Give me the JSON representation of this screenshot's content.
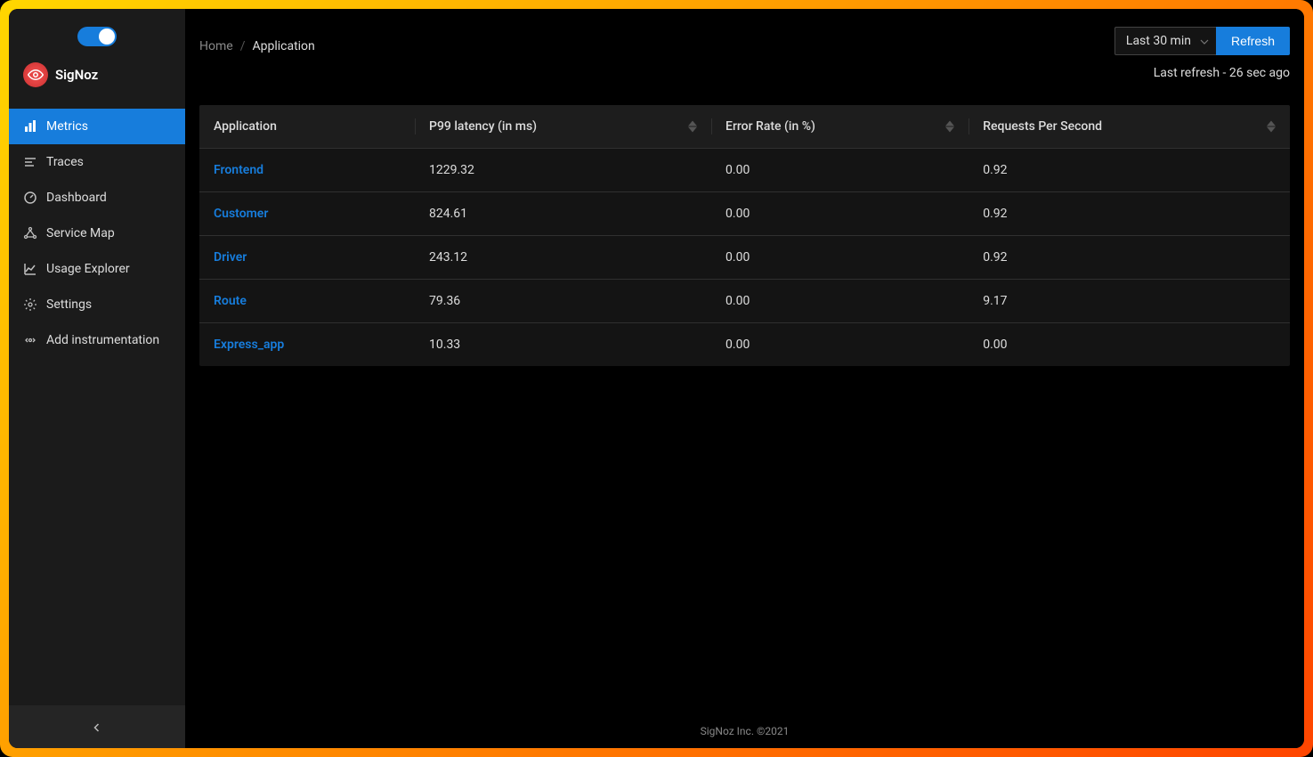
{
  "brand": {
    "name": "SigNoz"
  },
  "sidebar": {
    "items": [
      {
        "label": "Metrics",
        "icon": "chart-bar-icon",
        "active": true
      },
      {
        "label": "Traces",
        "icon": "align-left-icon",
        "active": false
      },
      {
        "label": "Dashboard",
        "icon": "dashboard-icon",
        "active": false
      },
      {
        "label": "Service Map",
        "icon": "deployment-icon",
        "active": false
      },
      {
        "label": "Usage Explorer",
        "icon": "line-chart-icon",
        "active": false
      },
      {
        "label": "Settings",
        "icon": "gear-icon",
        "active": false
      },
      {
        "label": "Add instrumentation",
        "icon": "api-icon",
        "active": false
      }
    ]
  },
  "breadcrumb": {
    "home": "Home",
    "current": "Application"
  },
  "controls": {
    "timerange": "Last 30 min",
    "refresh_label": "Refresh",
    "last_refresh": "Last refresh - 26 sec ago"
  },
  "table": {
    "columns": [
      {
        "label": "Application",
        "sortable": false
      },
      {
        "label": "P99 latency (in ms)",
        "sortable": true
      },
      {
        "label": "Error Rate (in %)",
        "sortable": true
      },
      {
        "label": "Requests Per Second",
        "sortable": true
      }
    ],
    "rows": [
      {
        "app": "Frontend",
        "p99": "1229.32",
        "error": "0.00",
        "rps": "0.92"
      },
      {
        "app": "Customer",
        "p99": "824.61",
        "error": "0.00",
        "rps": "0.92"
      },
      {
        "app": "Driver",
        "p99": "243.12",
        "error": "0.00",
        "rps": "0.92"
      },
      {
        "app": "Route",
        "p99": "79.36",
        "error": "0.00",
        "rps": "9.17"
      },
      {
        "app": "Express_app",
        "p99": "10.33",
        "error": "0.00",
        "rps": "0.00"
      }
    ]
  },
  "footer": {
    "text": "SigNoz Inc. ©2021"
  }
}
